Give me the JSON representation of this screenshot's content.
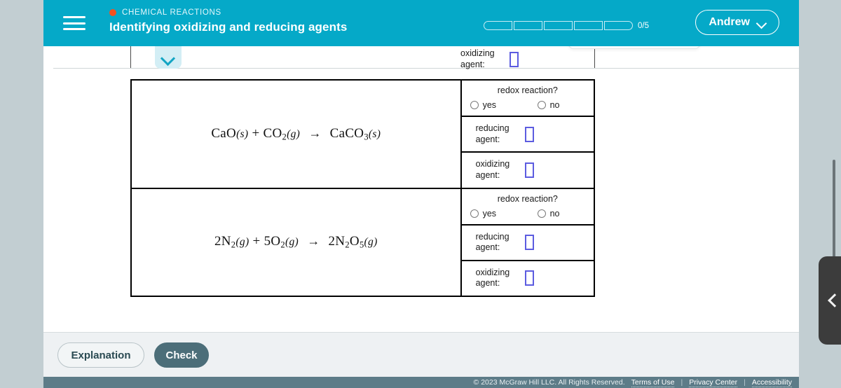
{
  "header": {
    "menu_icon": "hamburger-icon",
    "eyebrow": "CHEMICAL REACTIONS",
    "title": "Identifying oxidizing and reducing agents",
    "progress": {
      "label": "0/5",
      "total_segments": 5,
      "filled_segments": 0
    },
    "user": {
      "name": "Andrew",
      "caret_icon": "chevron-down-icon"
    }
  },
  "partial_row": {
    "label": "oxidizing agent:",
    "value": "",
    "collapse_icon": "chevron-down-icon"
  },
  "table": {
    "redox_question": "redox reaction?",
    "option_yes": "yes",
    "option_no": "no",
    "reducing_label": "reducing agent:",
    "oxidizing_label": "oxidizing agent:",
    "rows": [
      {
        "equation_html": "CaO<span class=\"st\">(s)</span> + CO<sub>2</sub><span class=\"st\">(g)</span> <span class=\"arrow\">&#8594;</span> CaCO<sub>3</sub><span class=\"st\">(s)</span>",
        "equation_text": "CaO(s) + CO2(g) → CaCO3(s)",
        "redox_selected": "",
        "reducing_agent_value": "",
        "oxidizing_agent_value": ""
      },
      {
        "equation_html": "2N<sub>2</sub><span class=\"st\">(g)</span> + 5O<sub>2</sub><span class=\"st\">(g)</span> <span class=\"arrow\">&#8594;</span> 2N<sub>2</sub>O<sub>5</sub><span class=\"st\">(g)</span>",
        "equation_text": "2N2(g) + 5O2(g) → 2N2O5(g)",
        "redox_selected": "",
        "reducing_agent_value": "",
        "oxidizing_agent_value": ""
      }
    ]
  },
  "actions": {
    "explanation_label": "Explanation",
    "check_label": "Check"
  },
  "legal": {
    "copyright": "© 2023 McGraw Hill LLC. All Rights Reserved.",
    "terms": "Terms of Use",
    "privacy": "Privacy Center",
    "accessibility": "Accessibility",
    "separator": "|"
  },
  "colors": {
    "header_teal": "#05a9c8",
    "page_bg": "#c2ced2",
    "action_bar": "#eef1f3",
    "check_button": "#4c6e79",
    "legal_bar": "#5d7c88",
    "input_border": "#5c5ce0",
    "eyebrow_dot": "#f4511e",
    "drawer_tab": "#3c3c3c"
  }
}
